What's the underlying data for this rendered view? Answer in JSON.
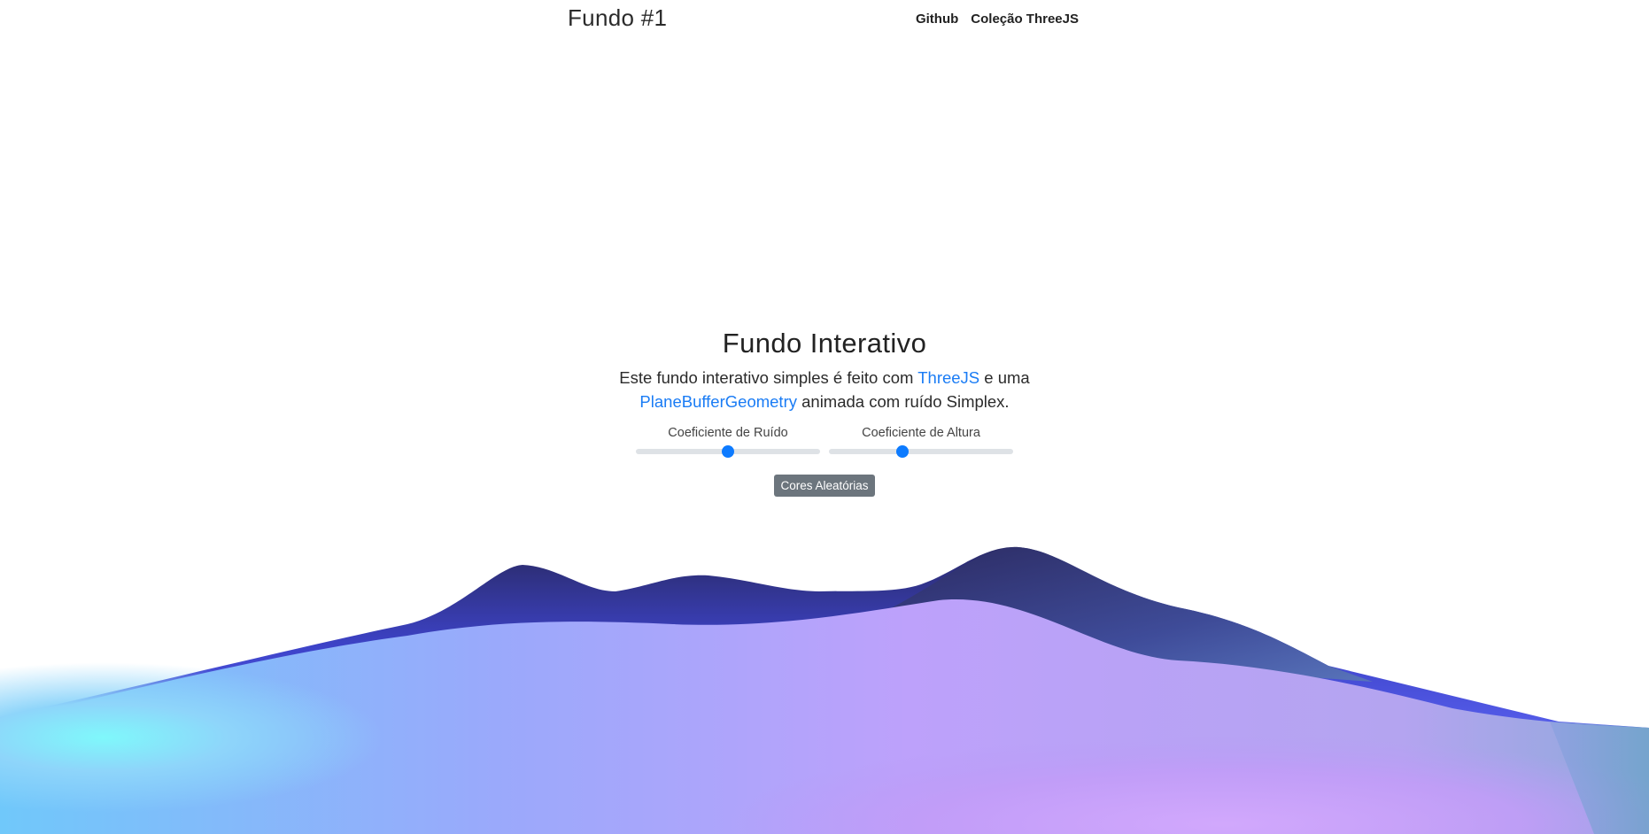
{
  "header": {
    "brand": "Fundo #1",
    "nav": [
      {
        "label": "Github"
      },
      {
        "label": "Coleção ThreeJS"
      }
    ]
  },
  "main": {
    "title": "Fundo Interativo",
    "desc_part1": "Este fundo interativo simples é feito com ",
    "link_threejs": "ThreeJS",
    "desc_part2": " e uma ",
    "link_geometry": "PlaneBufferGeometry",
    "desc_part3": " animada com ruído Simplex.",
    "sliders": [
      {
        "label": "Coeficiente de Ruído",
        "value_fraction": 0.5
      },
      {
        "label": "Coeficiente de Altura",
        "value_fraction": 0.4
      }
    ],
    "random_colors_button": "Cores Aleatórias"
  },
  "colors": {
    "accent": "#0d7bff",
    "link": "#1a7cf5",
    "button_bg": "#6c757d",
    "wave_deep": "#2a2a6a",
    "wave_blue": "#4e57f5",
    "wave_cyan": "#7ff8fb",
    "wave_violet": "#d4a6ff",
    "wave_steel": "#4f6aa8"
  }
}
